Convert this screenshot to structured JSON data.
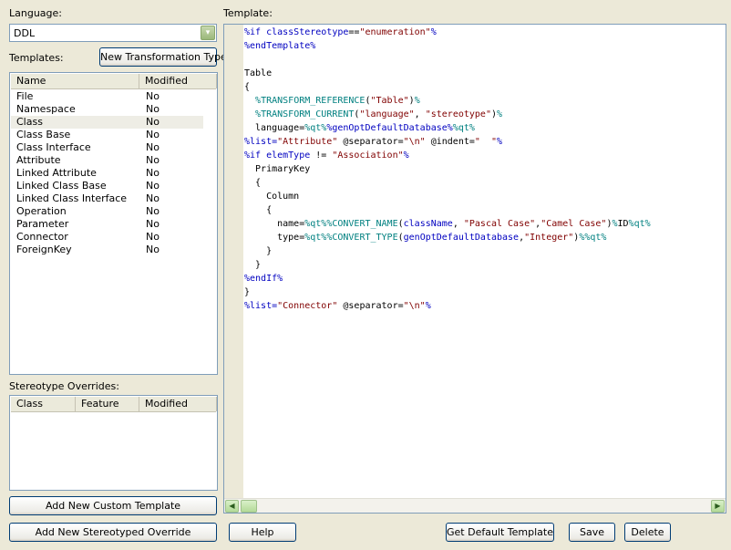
{
  "language": {
    "label": "Language:",
    "selected": "DDL"
  },
  "templates": {
    "label": "Templates:",
    "new_type_button": "New Transformation Type",
    "columns": [
      "Name",
      "Modified"
    ],
    "rows": [
      {
        "name": "File",
        "modified": "No"
      },
      {
        "name": "Namespace",
        "modified": "No"
      },
      {
        "name": "Class",
        "modified": "No"
      },
      {
        "name": "Class Base",
        "modified": "No"
      },
      {
        "name": "Class Interface",
        "modified": "No"
      },
      {
        "name": "Attribute",
        "modified": "No"
      },
      {
        "name": "Linked Attribute",
        "modified": "No"
      },
      {
        "name": "Linked Class Base",
        "modified": "No"
      },
      {
        "name": "Linked Class Interface",
        "modified": "No"
      },
      {
        "name": "Operation",
        "modified": "No"
      },
      {
        "name": "Parameter",
        "modified": "No"
      },
      {
        "name": "Connector",
        "modified": "No"
      },
      {
        "name": "ForeignKey",
        "modified": "No"
      }
    ]
  },
  "overrides": {
    "label": "Stereotype Overrides:",
    "columns": [
      "Class",
      "Feature",
      "Modified"
    ]
  },
  "editor": {
    "label": "Template:",
    "lines": [
      [
        [
          "k",
          "%if classStereotype"
        ],
        [
          "",
          "=="
        ],
        [
          "s",
          "\"enumeration\""
        ],
        [
          "k",
          "%"
        ]
      ],
      [
        [
          "k",
          "%endTemplate%"
        ]
      ],
      [
        [
          "",
          ""
        ]
      ],
      [
        [
          "",
          "Table"
        ]
      ],
      [
        [
          "",
          "{"
        ]
      ],
      [
        [
          "",
          "  "
        ],
        [
          "m",
          "%TRANSFORM_REFERENCE"
        ],
        [
          "",
          "("
        ],
        [
          "s",
          "\"Table\""
        ],
        [
          "",
          ")"
        ],
        [
          "m",
          "%"
        ]
      ],
      [
        [
          "",
          "  "
        ],
        [
          "m",
          "%TRANSFORM_CURRENT"
        ],
        [
          "",
          "("
        ],
        [
          "s",
          "\"language\""
        ],
        [
          "",
          ", "
        ],
        [
          "s",
          "\"stereotype\""
        ],
        [
          "",
          ")"
        ],
        [
          "m",
          "%"
        ]
      ],
      [
        [
          "",
          "  language="
        ],
        [
          "m",
          "%qt%"
        ],
        [
          "p",
          "%genOptDefaultDatabase%"
        ],
        [
          "m",
          "%qt%"
        ]
      ],
      [
        [
          "k",
          "%list="
        ],
        [
          "s",
          "\"Attribute\""
        ],
        [
          "",
          " @separator="
        ],
        [
          "s",
          "\"\\n\""
        ],
        [
          "",
          " @indent="
        ],
        [
          "s",
          "\"  \""
        ],
        [
          "k",
          "%"
        ]
      ],
      [
        [
          "k",
          "%if elemType"
        ],
        [
          "",
          " != "
        ],
        [
          "s",
          "\"Association\""
        ],
        [
          "k",
          "%"
        ]
      ],
      [
        [
          "",
          "  PrimaryKey"
        ]
      ],
      [
        [
          "",
          "  {"
        ]
      ],
      [
        [
          "",
          "    Column"
        ]
      ],
      [
        [
          "",
          "    {"
        ]
      ],
      [
        [
          "",
          "      name="
        ],
        [
          "m",
          "%qt%"
        ],
        [
          "m",
          "%CONVERT_NAME"
        ],
        [
          "",
          "("
        ],
        [
          "p",
          "className"
        ],
        [
          "",
          ", "
        ],
        [
          "s",
          "\"Pascal Case\""
        ],
        [
          "",
          ","
        ],
        [
          "s",
          "\"Camel Case\""
        ],
        [
          "",
          ")"
        ],
        [
          "m",
          "%"
        ],
        [
          "",
          "ID"
        ],
        [
          "m",
          "%qt%"
        ]
      ],
      [
        [
          "",
          "      type="
        ],
        [
          "m",
          "%qt%"
        ],
        [
          "m",
          "%CONVERT_TYPE"
        ],
        [
          "",
          "("
        ],
        [
          "p",
          "genOptDefaultDatabase"
        ],
        [
          "",
          ","
        ],
        [
          "s",
          "\"Integer\""
        ],
        [
          "",
          ")"
        ],
        [
          "m",
          "%"
        ],
        [
          "m",
          "%qt%"
        ]
      ],
      [
        [
          "",
          "    }"
        ]
      ],
      [
        [
          "",
          "  }"
        ]
      ],
      [
        [
          "k",
          "%endIf%"
        ]
      ],
      [
        [
          "",
          "}"
        ]
      ],
      [
        [
          "k",
          "%list="
        ],
        [
          "s",
          "\"Connector\""
        ],
        [
          "",
          " @separator="
        ],
        [
          "s",
          "\"\\n\""
        ],
        [
          "k",
          "%"
        ]
      ]
    ],
    "scroll_left_glyph": "◀",
    "scroll_right_glyph": "▶"
  },
  "buttons": {
    "add_custom": "Add New Custom Template",
    "add_stereotyped": "Add New Stereotyped Override",
    "help": "Help",
    "get_default": "Get Default Template",
    "save": "Save",
    "delete": "Delete"
  },
  "icons": {
    "combo_arrow": "▾"
  },
  "colors": {
    "keyword": "#0000c0",
    "string": "#800000",
    "macro": "#008080",
    "selected_row": "#eeede5"
  }
}
